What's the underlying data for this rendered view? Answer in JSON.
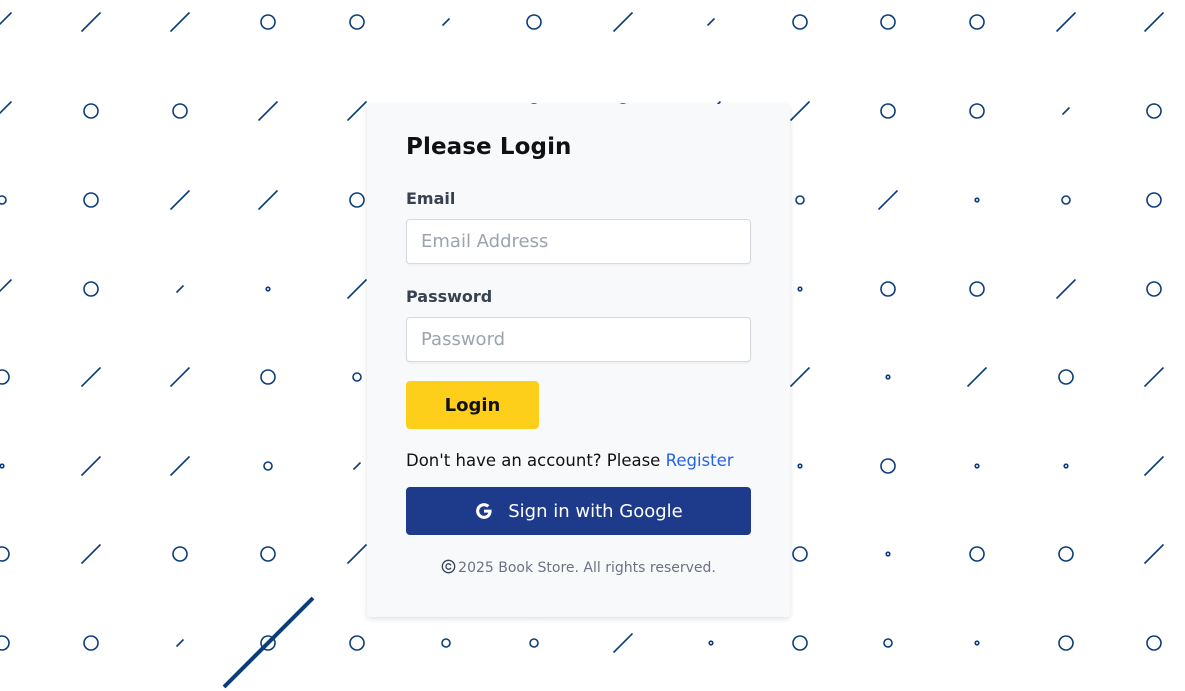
{
  "colors": {
    "pattern": "#0b3d7a",
    "accent_yellow": "#fdcf1b",
    "google_button": "#1e3a8a",
    "link": "#2563eb",
    "card_bg": "#f8f9fb"
  },
  "login_card": {
    "title": "Please Login",
    "email_label": "Email",
    "email_placeholder": "Email Address",
    "email_value": "",
    "password_label": "Password",
    "password_placeholder": "Password",
    "password_value": "",
    "login_button_label": "Login",
    "register_prompt": "Don't have an account? Please",
    "register_link": "Register",
    "google_button_label": "Sign in with Google",
    "google_icon": "google-g-icon",
    "footer_text": "2025 Book Store. All rights reserved.",
    "footer_icon": "copyright-icon"
  }
}
